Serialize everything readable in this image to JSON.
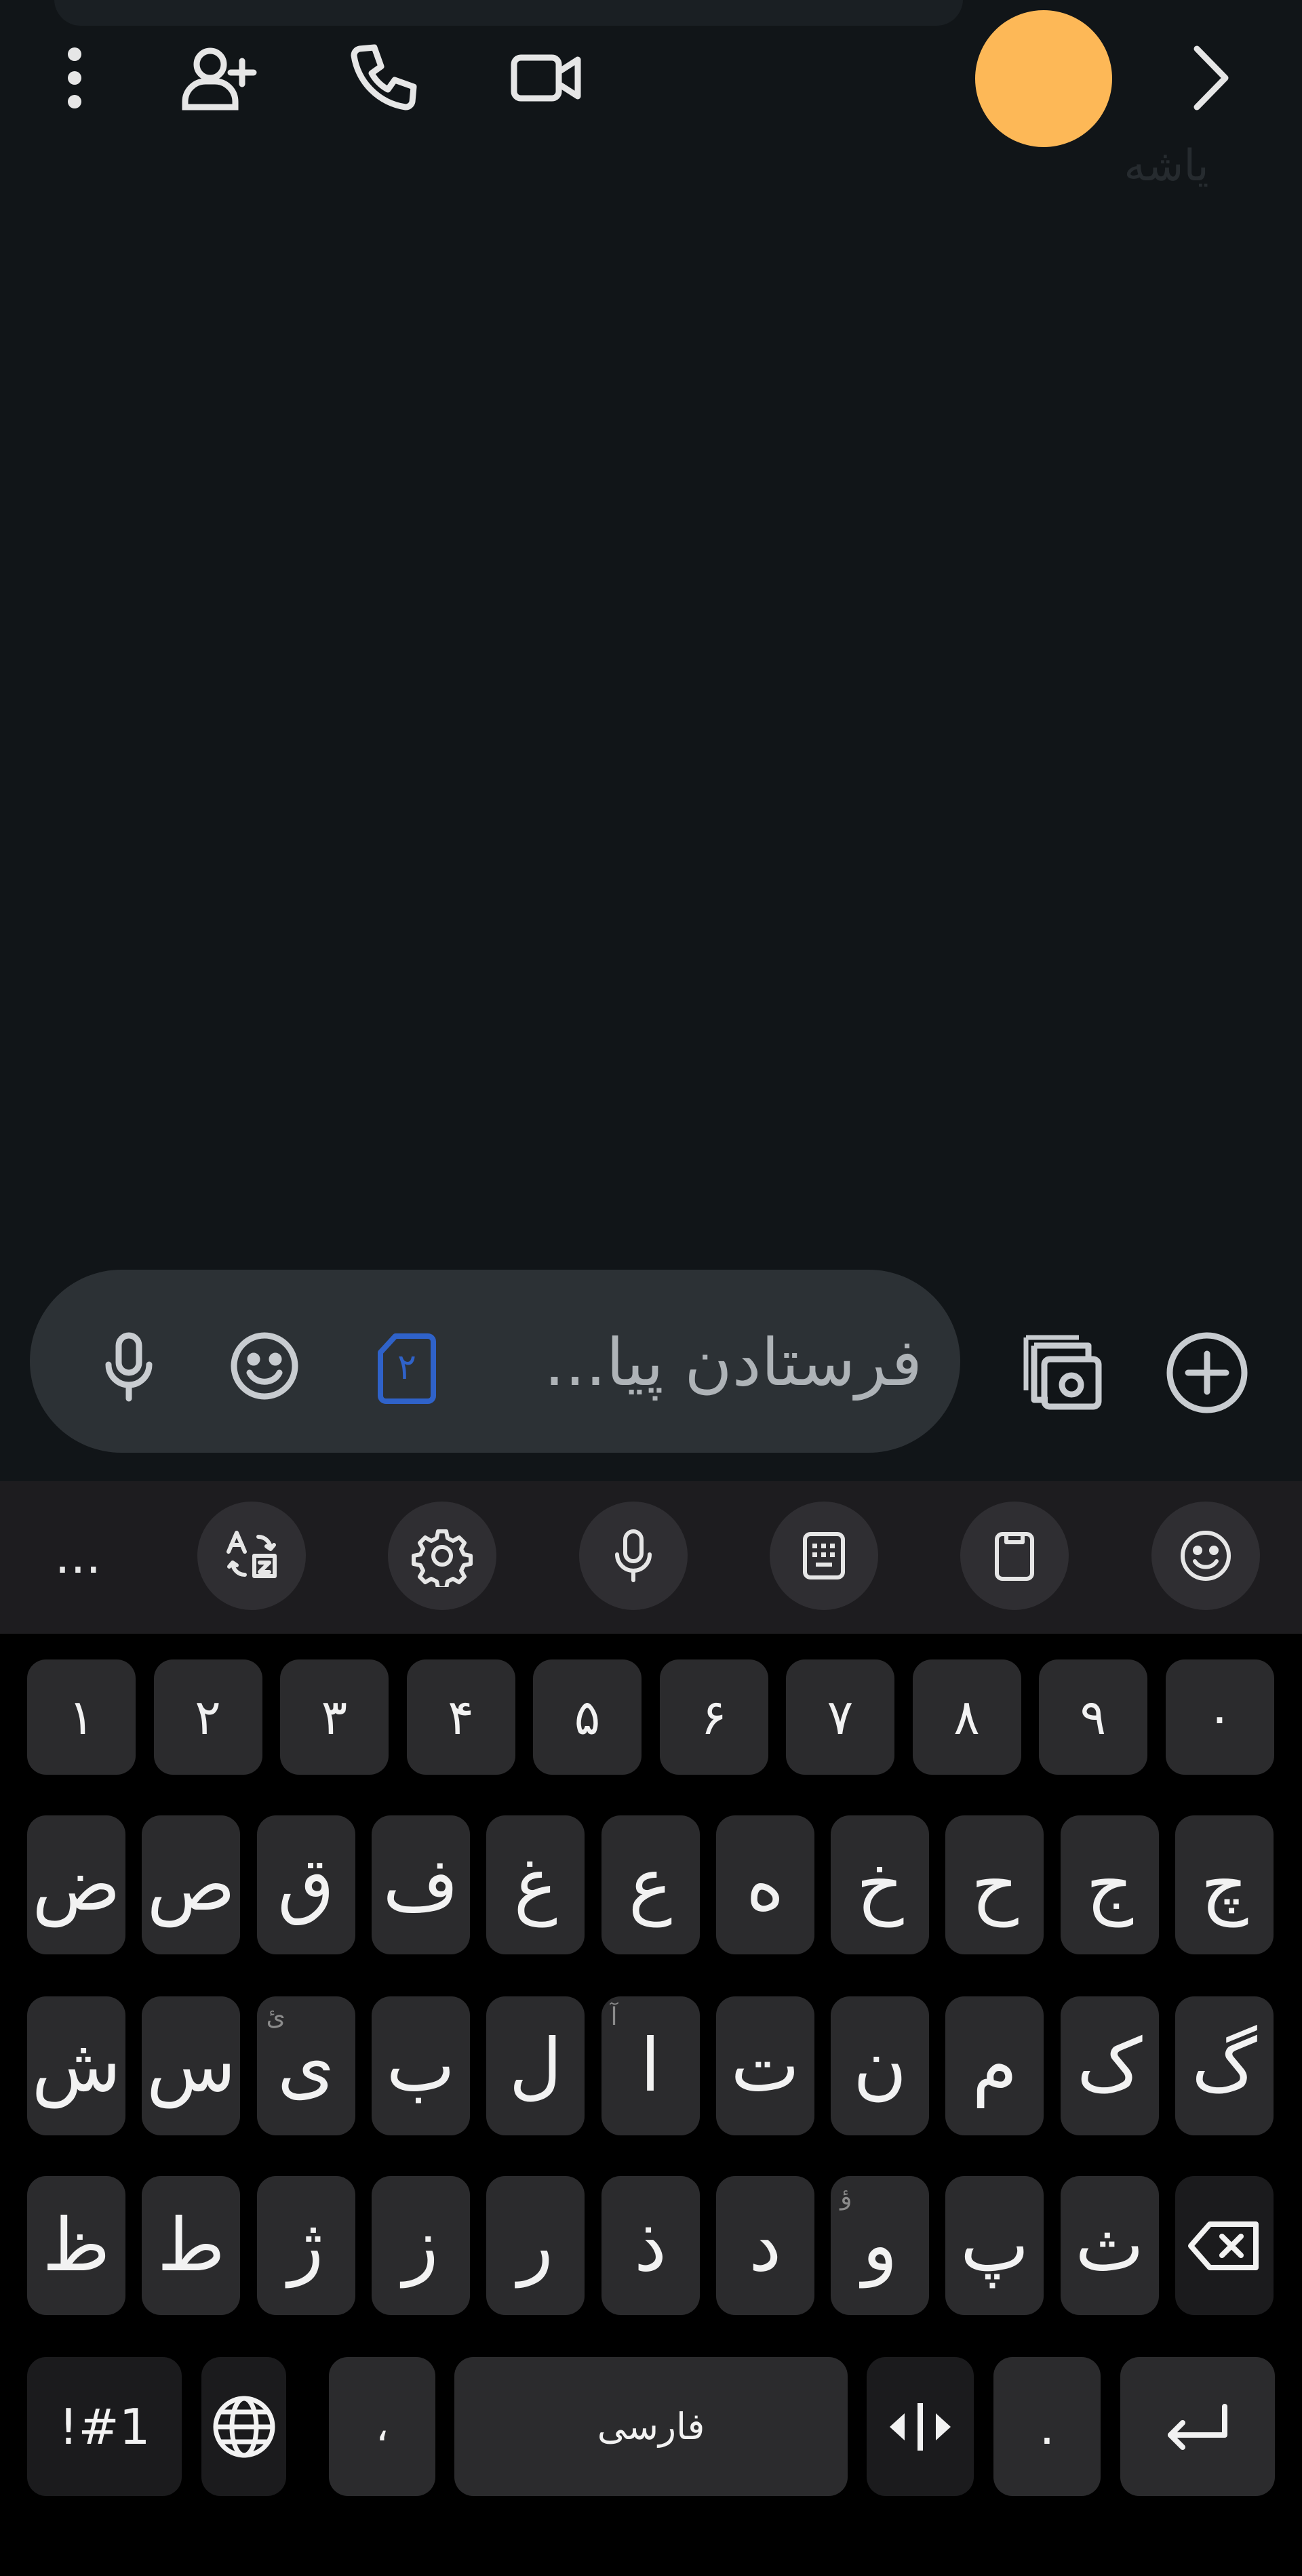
{
  "header": {
    "contact_name": "یاشه",
    "icons": [
      "more-vert-icon",
      "add-person-icon",
      "phone-icon",
      "video-call-icon",
      "chevron-right-icon"
    ],
    "avatar_color": "#fdb857"
  },
  "compose": {
    "placeholder": "فرستادن پیا...",
    "sim_number": "۲",
    "sim_color": "#2f62c9"
  },
  "keyboard_toolbar": {
    "more_label": "...",
    "icons": [
      "translate-icon",
      "settings-icon",
      "mic-icon",
      "keyboard-layout-icon",
      "clipboard-icon",
      "emoji-icon"
    ]
  },
  "keyboard": {
    "number_row": [
      "۱",
      "۲",
      "۳",
      "۴",
      "۵",
      "۶",
      "۷",
      "۸",
      "۹",
      "۰"
    ],
    "row1": [
      "ض",
      "ص",
      "ق",
      "ف",
      "غ",
      "ع",
      "ه",
      "خ",
      "ح",
      "ج",
      "چ"
    ],
    "row2": [
      "ش",
      "س",
      "ی",
      "ب",
      "ل",
      "ا",
      "ت",
      "ن",
      "م",
      "ک",
      "گ"
    ],
    "row2_hints": {
      "2": "ئ",
      "5": "آ"
    },
    "row3": [
      "ظ",
      "ط",
      "ژ",
      "ز",
      "ر",
      "ذ",
      "د",
      "و",
      "پ",
      "ث"
    ],
    "row3_hints": {
      "7": "ؤ"
    },
    "symbols_label": "!#1",
    "comma_label": "،",
    "space_label": "فارسی",
    "period_label": "."
  }
}
